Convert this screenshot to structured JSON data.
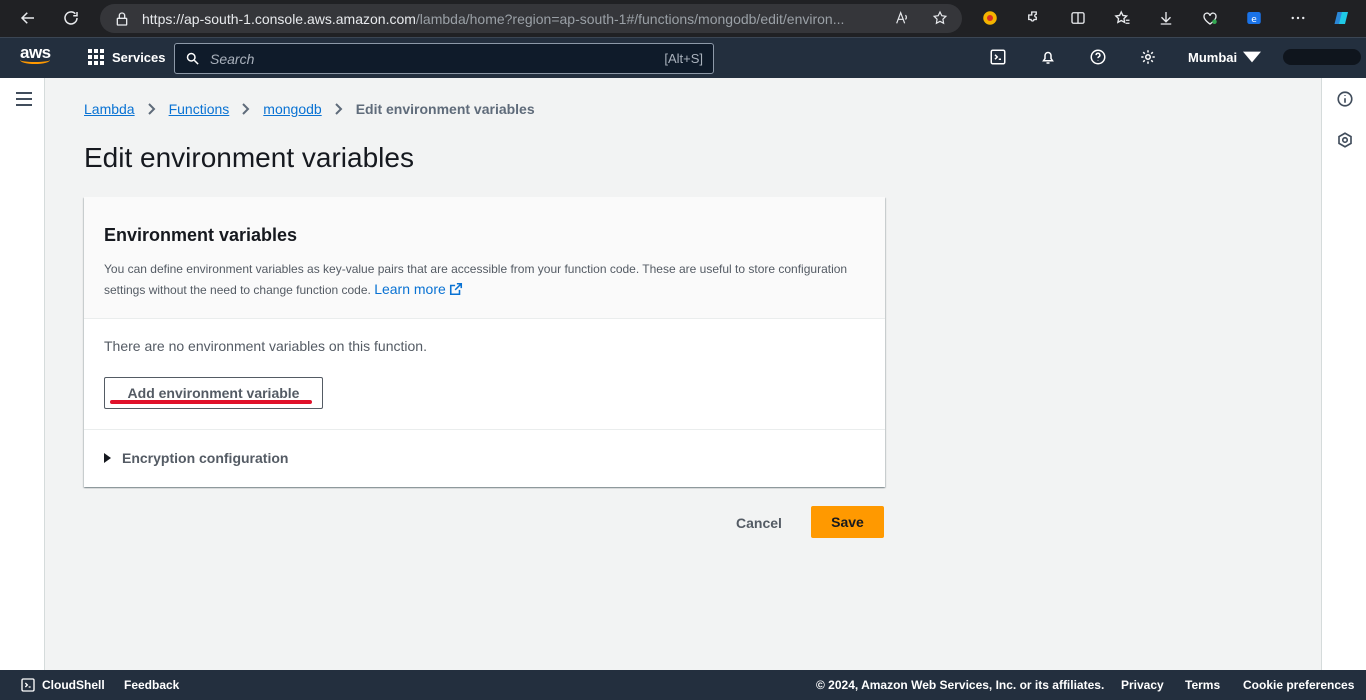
{
  "browser": {
    "url_host": "https://ap-south-1.console.aws.amazon.com",
    "url_rest": "/lambda/home?region=ap-south-1#/functions/mongodb/edit/environ..."
  },
  "aws_nav": {
    "logo": "aws",
    "services_label": "Services",
    "search_placeholder": "Search",
    "search_shortcut": "[Alt+S]",
    "region": "Mumbai"
  },
  "breadcrumb": [
    {
      "label": "Lambda"
    },
    {
      "label": "Functions"
    },
    {
      "label": "mongodb"
    },
    {
      "label": "Edit environment variables"
    }
  ],
  "page": {
    "title": "Edit environment variables"
  },
  "panel": {
    "title": "Environment variables",
    "description": "You can define environment variables as key-value pairs that are accessible from your function code. These are useful to store configuration settings without the need to change function code.",
    "learn_more": "Learn more",
    "empty_text": "There are no environment variables on this function.",
    "add_button": "Add environment variable",
    "encryption_label": "Encryption configuration"
  },
  "actions": {
    "cancel": "Cancel",
    "save": "Save"
  },
  "footer": {
    "cloudshell": "CloudShell",
    "feedback": "Feedback",
    "copyright": "© 2024, Amazon Web Services, Inc. or its affiliates.",
    "privacy": "Privacy",
    "terms": "Terms",
    "cookie": "Cookie preferences"
  },
  "colors": {
    "nav_bg": "#232f3e",
    "accent": "#ff9900",
    "link": "#0972d3",
    "highlight": "#e0112b"
  }
}
